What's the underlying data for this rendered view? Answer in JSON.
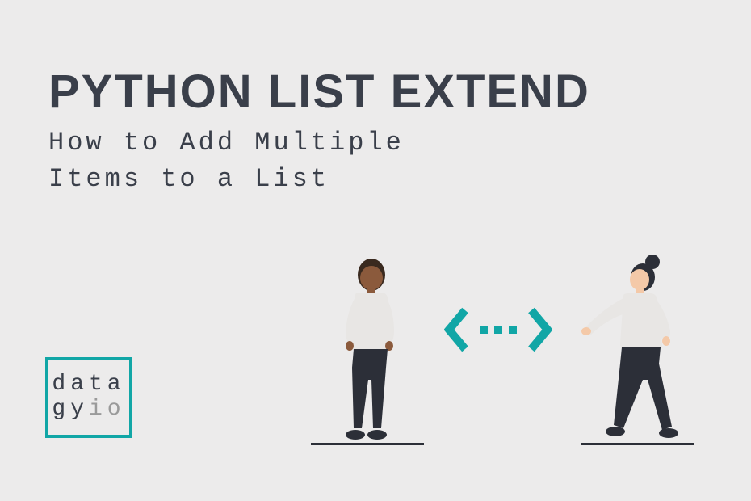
{
  "title": "PYTHON LIST EXTEND",
  "subtitle": "How to Add Multiple Items to a List",
  "logo": {
    "line1": "data",
    "gy": "gy",
    "io": "io"
  },
  "colors": {
    "accent": "#11a6a6",
    "text": "#3a3f4a",
    "muted": "#9a9a9a",
    "bg": "#ecebeb"
  }
}
